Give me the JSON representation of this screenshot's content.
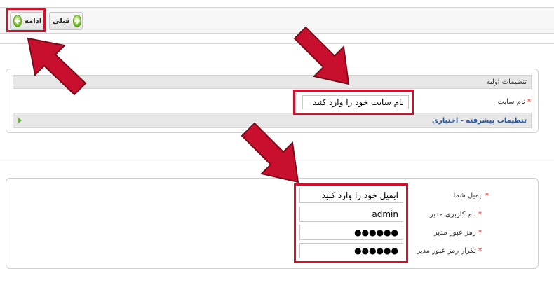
{
  "toolbar": {
    "next_label": "ادامه",
    "prev_label": "قبلی"
  },
  "basic_settings": {
    "header": "تنظیمات اولیه",
    "site_name_label": "نام سایت",
    "required_mark": "*",
    "site_name_value": "نام سایت خود را وارد کنید",
    "advanced_label": "تنظیمات پیشرفته - اختیاری"
  },
  "admin": {
    "email_label": "ایمیل شما",
    "email_value": "ایمیل خود را وارد کنید",
    "username_label": "نام کاربری مدیر",
    "username_value": "admin",
    "password_label": "رمز عبور مدیر",
    "password_value": "●●●●●●",
    "confirm_label": "تکرار رمز عبور مدیر",
    "confirm_value": "●●●●●●",
    "required_mark": "*"
  },
  "colors": {
    "highlight": "#d1112a",
    "button_green": "#7cc22f",
    "link_blue": "#2c5aa0"
  }
}
